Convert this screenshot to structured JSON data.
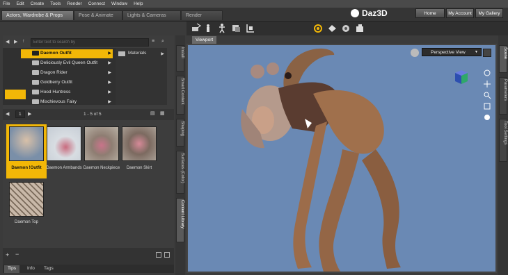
{
  "menu": [
    "File",
    "Edit",
    "Create",
    "Tools",
    "Render",
    "Connect",
    "Window",
    "Help"
  ],
  "tabs": [
    "Actors, Wardrobe & Props",
    "Pose & Animate",
    "Lights & Cameras",
    "Render"
  ],
  "brand": "Daz3D",
  "top_buttons": [
    "Home",
    "My Account",
    "My Gallery"
  ],
  "search": {
    "placeholder": "Enter text to search by"
  },
  "tree": [
    {
      "label": "Daemon Outfit",
      "selected": true
    },
    {
      "label": "Deliciously Evil Queen Outfit",
      "selected": false
    },
    {
      "label": "Dragon Rider",
      "selected": false
    },
    {
      "label": "Goldberry Outfit",
      "selected": false
    },
    {
      "label": "Hood Huntress",
      "selected": false
    },
    {
      "label": "Mischievous Fairy",
      "selected": false
    }
  ],
  "subtree": {
    "label": "Materials"
  },
  "pager": {
    "page": "1",
    "count": "1 - 5 of 5"
  },
  "items": [
    {
      "label": "Daemon !Outfit",
      "selected": true
    },
    {
      "label": "Daemon Armbands",
      "selected": false
    },
    {
      "label": "Daemon Neckpiece",
      "selected": false
    },
    {
      "label": "Daemon Skirt",
      "selected": false
    },
    {
      "label": "Daemon Top",
      "selected": false
    }
  ],
  "bottom_tabs": [
    "Tips",
    "Info",
    "Tags"
  ],
  "side_tabs": [
    "Install",
    "Smart Content",
    "Shaping",
    "Surfaces (Color)",
    "Content Library"
  ],
  "right_tabs": [
    "Scene",
    "Parameters",
    "Tool Settings"
  ],
  "viewport": {
    "tab_label": "Viewport",
    "camera": "Perspective View"
  },
  "colors": {
    "accent": "#f2b707",
    "viewport_bg": "#6a89b4",
    "panel_bg": "#3d3d3d"
  }
}
